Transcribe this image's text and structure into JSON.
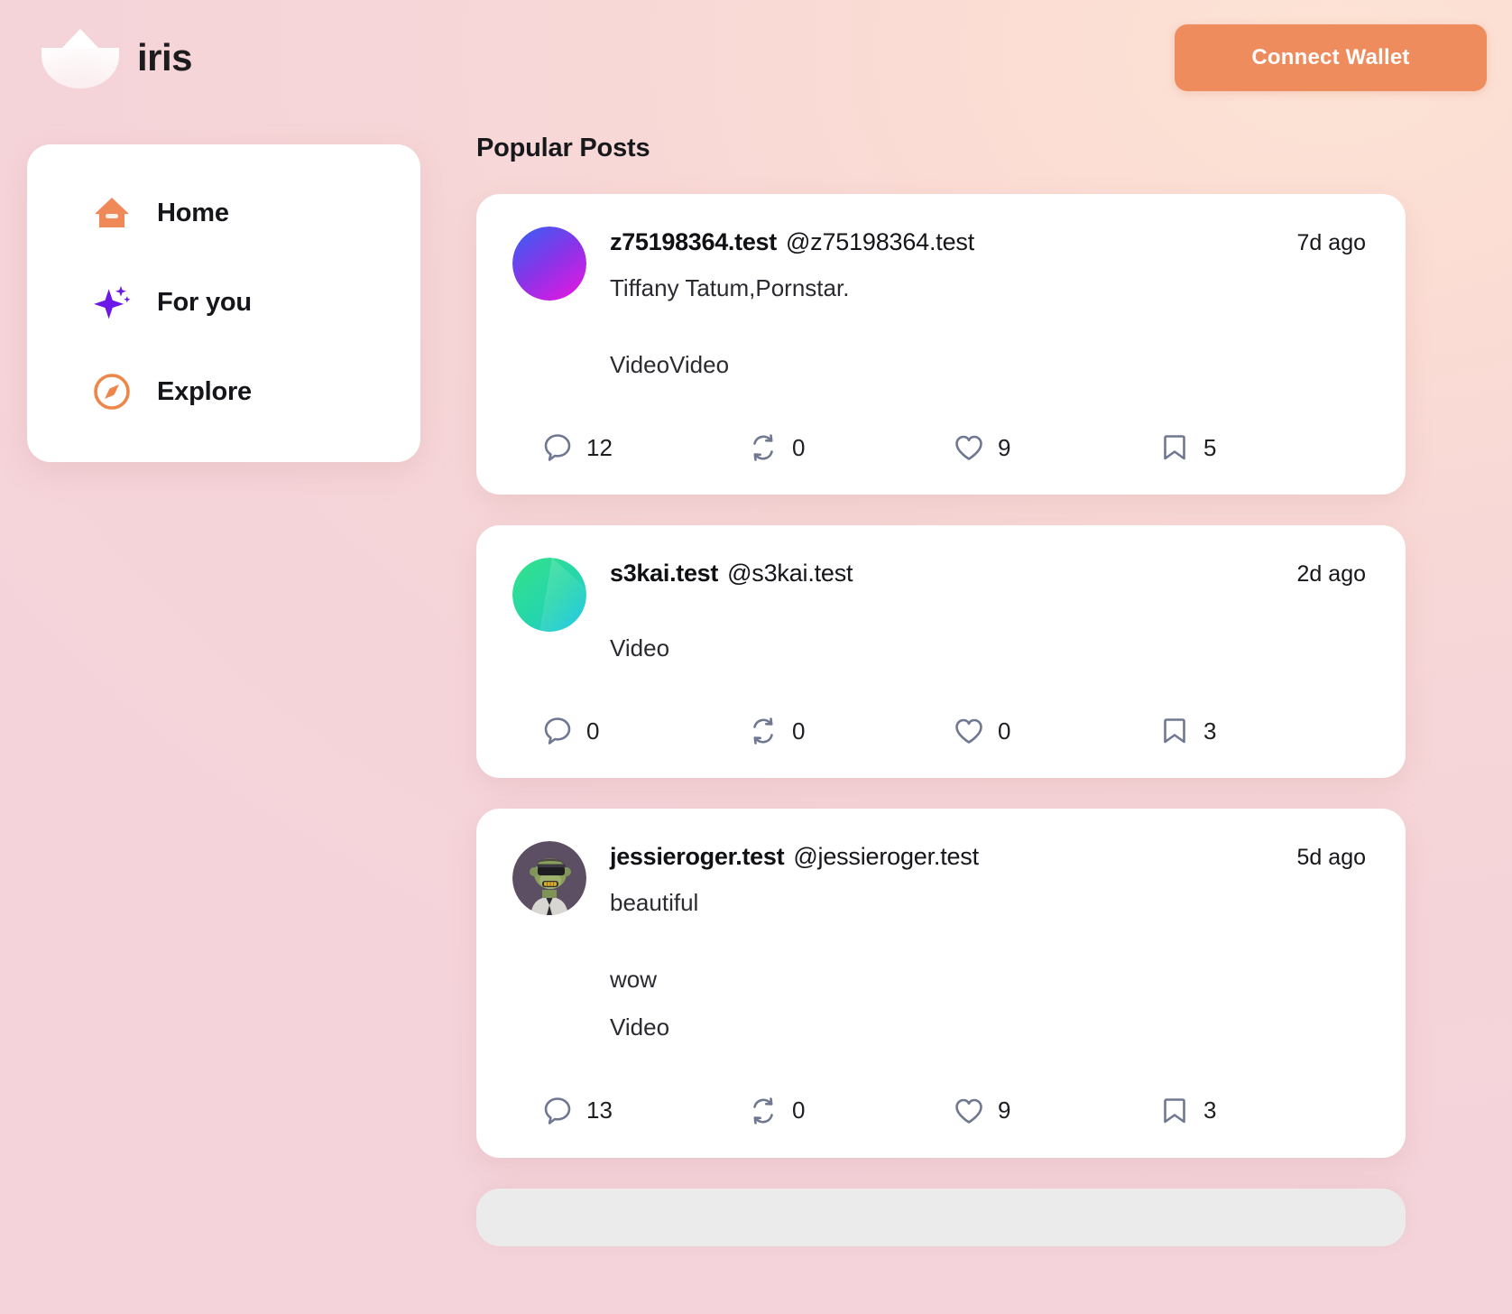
{
  "app": {
    "brand_name": "iris",
    "logo_icon": "lotus-petal-logo"
  },
  "header": {
    "connect_wallet_label": "Connect Wallet",
    "accent_color": "#ee8c5d"
  },
  "sidebar": {
    "items": [
      {
        "label": "Home",
        "icon": "home-icon",
        "icon_color": "#ef8a58"
      },
      {
        "label": "For you",
        "icon": "sparkle-icon",
        "icon_color": "#6b18e8"
      },
      {
        "label": "Explore",
        "icon": "compass-icon",
        "icon_color": "#ee8549"
      }
    ]
  },
  "feed": {
    "title": "Popular Posts",
    "action_icons": {
      "comment": "comment-icon",
      "repost": "repost-icon",
      "like": "heart-icon",
      "bookmark": "bookmark-icon"
    },
    "posts": [
      {
        "display_name": "z75198364.test",
        "handle": "@z75198364.test",
        "timestamp": "7d ago",
        "avatar": "gradient-blue-magenta-avatar",
        "lines": [
          "Tiffany Tatum,Pornstar.",
          "VideoVideo"
        ],
        "comments": "12",
        "reposts": "0",
        "likes": "9",
        "bookmarks": "5"
      },
      {
        "display_name": "s3kai.test",
        "handle": "@s3kai.test",
        "timestamp": "2d ago",
        "avatar": "gradient-green-cyan-avatar",
        "lines": [
          "Video"
        ],
        "comments": "0",
        "reposts": "0",
        "likes": "0",
        "bookmarks": "3"
      },
      {
        "display_name": "jessieroger.test",
        "handle": "@jessieroger.test",
        "timestamp": "5d ago",
        "avatar": "bored-ape-nft-avatar",
        "lines": [
          "beautiful",
          "wow",
          "Video"
        ],
        "comments": "13",
        "reposts": "0",
        "likes": "9",
        "bookmarks": "3"
      }
    ]
  }
}
